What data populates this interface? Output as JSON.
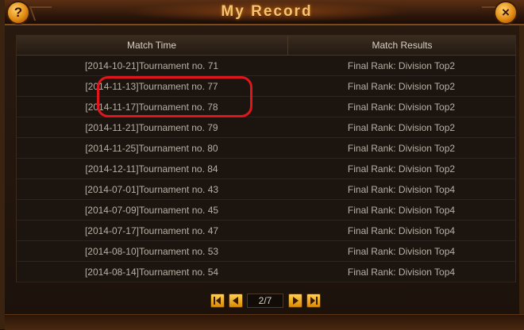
{
  "window": {
    "title": "My Record",
    "help_glyph": "?",
    "close_glyph": "×"
  },
  "table": {
    "headers": [
      "Match Time",
      "Match Results"
    ],
    "rows": [
      {
        "time": "[2014-10-21]Tournament no. 71",
        "result": "Final Rank: Division Top2"
      },
      {
        "time": "[2014-11-13]Tournament no. 77",
        "result": "Final Rank: Division Top2"
      },
      {
        "time": "[2014-11-17]Tournament no. 78",
        "result": "Final Rank: Division Top2"
      },
      {
        "time": "[2014-11-21]Tournament no. 79",
        "result": "Final Rank: Division Top2"
      },
      {
        "time": "[2014-11-25]Tournament no. 80",
        "result": "Final Rank: Division Top2"
      },
      {
        "time": "[2014-12-11]Tournament no. 84",
        "result": "Final Rank: Division Top2"
      },
      {
        "time": "[2014-07-01]Tournament no. 43",
        "result": "Final Rank: Division Top4"
      },
      {
        "time": "[2014-07-09]Tournament no. 45",
        "result": "Final Rank: Division Top4"
      },
      {
        "time": "[2014-07-17]Tournament no. 47",
        "result": "Final Rank: Division Top4"
      },
      {
        "time": "[2014-08-10]Tournament no. 53",
        "result": "Final Rank: Division Top4"
      },
      {
        "time": "[2014-08-14]Tournament no. 54",
        "result": "Final Rank: Division Top4"
      }
    ]
  },
  "pager": {
    "page_label": "2/7"
  },
  "icons": {
    "help": "help-icon",
    "close": "close-icon",
    "first": "first-page-icon",
    "prev": "previous-page-icon",
    "next": "next-page-icon",
    "last": "last-page-icon"
  },
  "colors": {
    "title": "#f2c56e",
    "highlight": "#e0161c",
    "button_gold": "#ffd24a"
  }
}
